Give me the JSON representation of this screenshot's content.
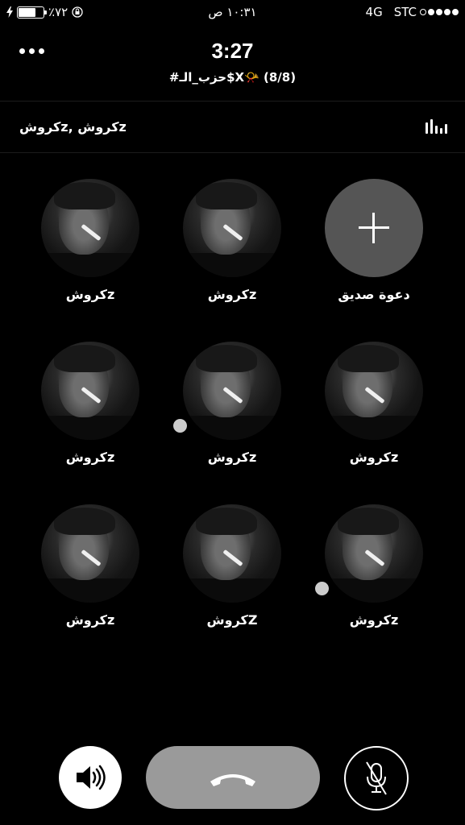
{
  "status_bar": {
    "battery_percent": "٪٧٢",
    "battery_level": 0.72,
    "time": "١٠:٣١ ص",
    "network": "4G",
    "carrier": "STC",
    "signal_strength": 4
  },
  "call": {
    "elapsed": "3:27",
    "group_name": "#حزب_الـ$X📯 (8/8)",
    "participants_names": "كروشz, كروشz"
  },
  "grid": [
    {
      "label": "كروشz",
      "type": "participant",
      "status_dot": false
    },
    {
      "label": "كروشz",
      "type": "participant",
      "status_dot": false
    },
    {
      "label": "دعوة صديق",
      "type": "invite",
      "status_dot": false
    },
    {
      "label": "كروشz",
      "type": "participant",
      "status_dot": false
    },
    {
      "label": "كروشz",
      "type": "participant",
      "status_dot": true
    },
    {
      "label": "كروشz",
      "type": "participant",
      "status_dot": false
    },
    {
      "label": "كروشz",
      "type": "participant",
      "status_dot": false
    },
    {
      "label": "كروشZ",
      "type": "participant",
      "status_dot": false
    },
    {
      "label": "كروشz",
      "type": "participant",
      "status_dot": true
    }
  ],
  "controls": {
    "speaker_icon": "speaker-icon",
    "end_icon": "phone-hangup-icon",
    "mute_icon": "mic-off-icon"
  },
  "colors": {
    "background": "#000000",
    "end_button": "#9a9a9a",
    "invite_circle": "#555555",
    "status_dot": "#cccccc"
  }
}
